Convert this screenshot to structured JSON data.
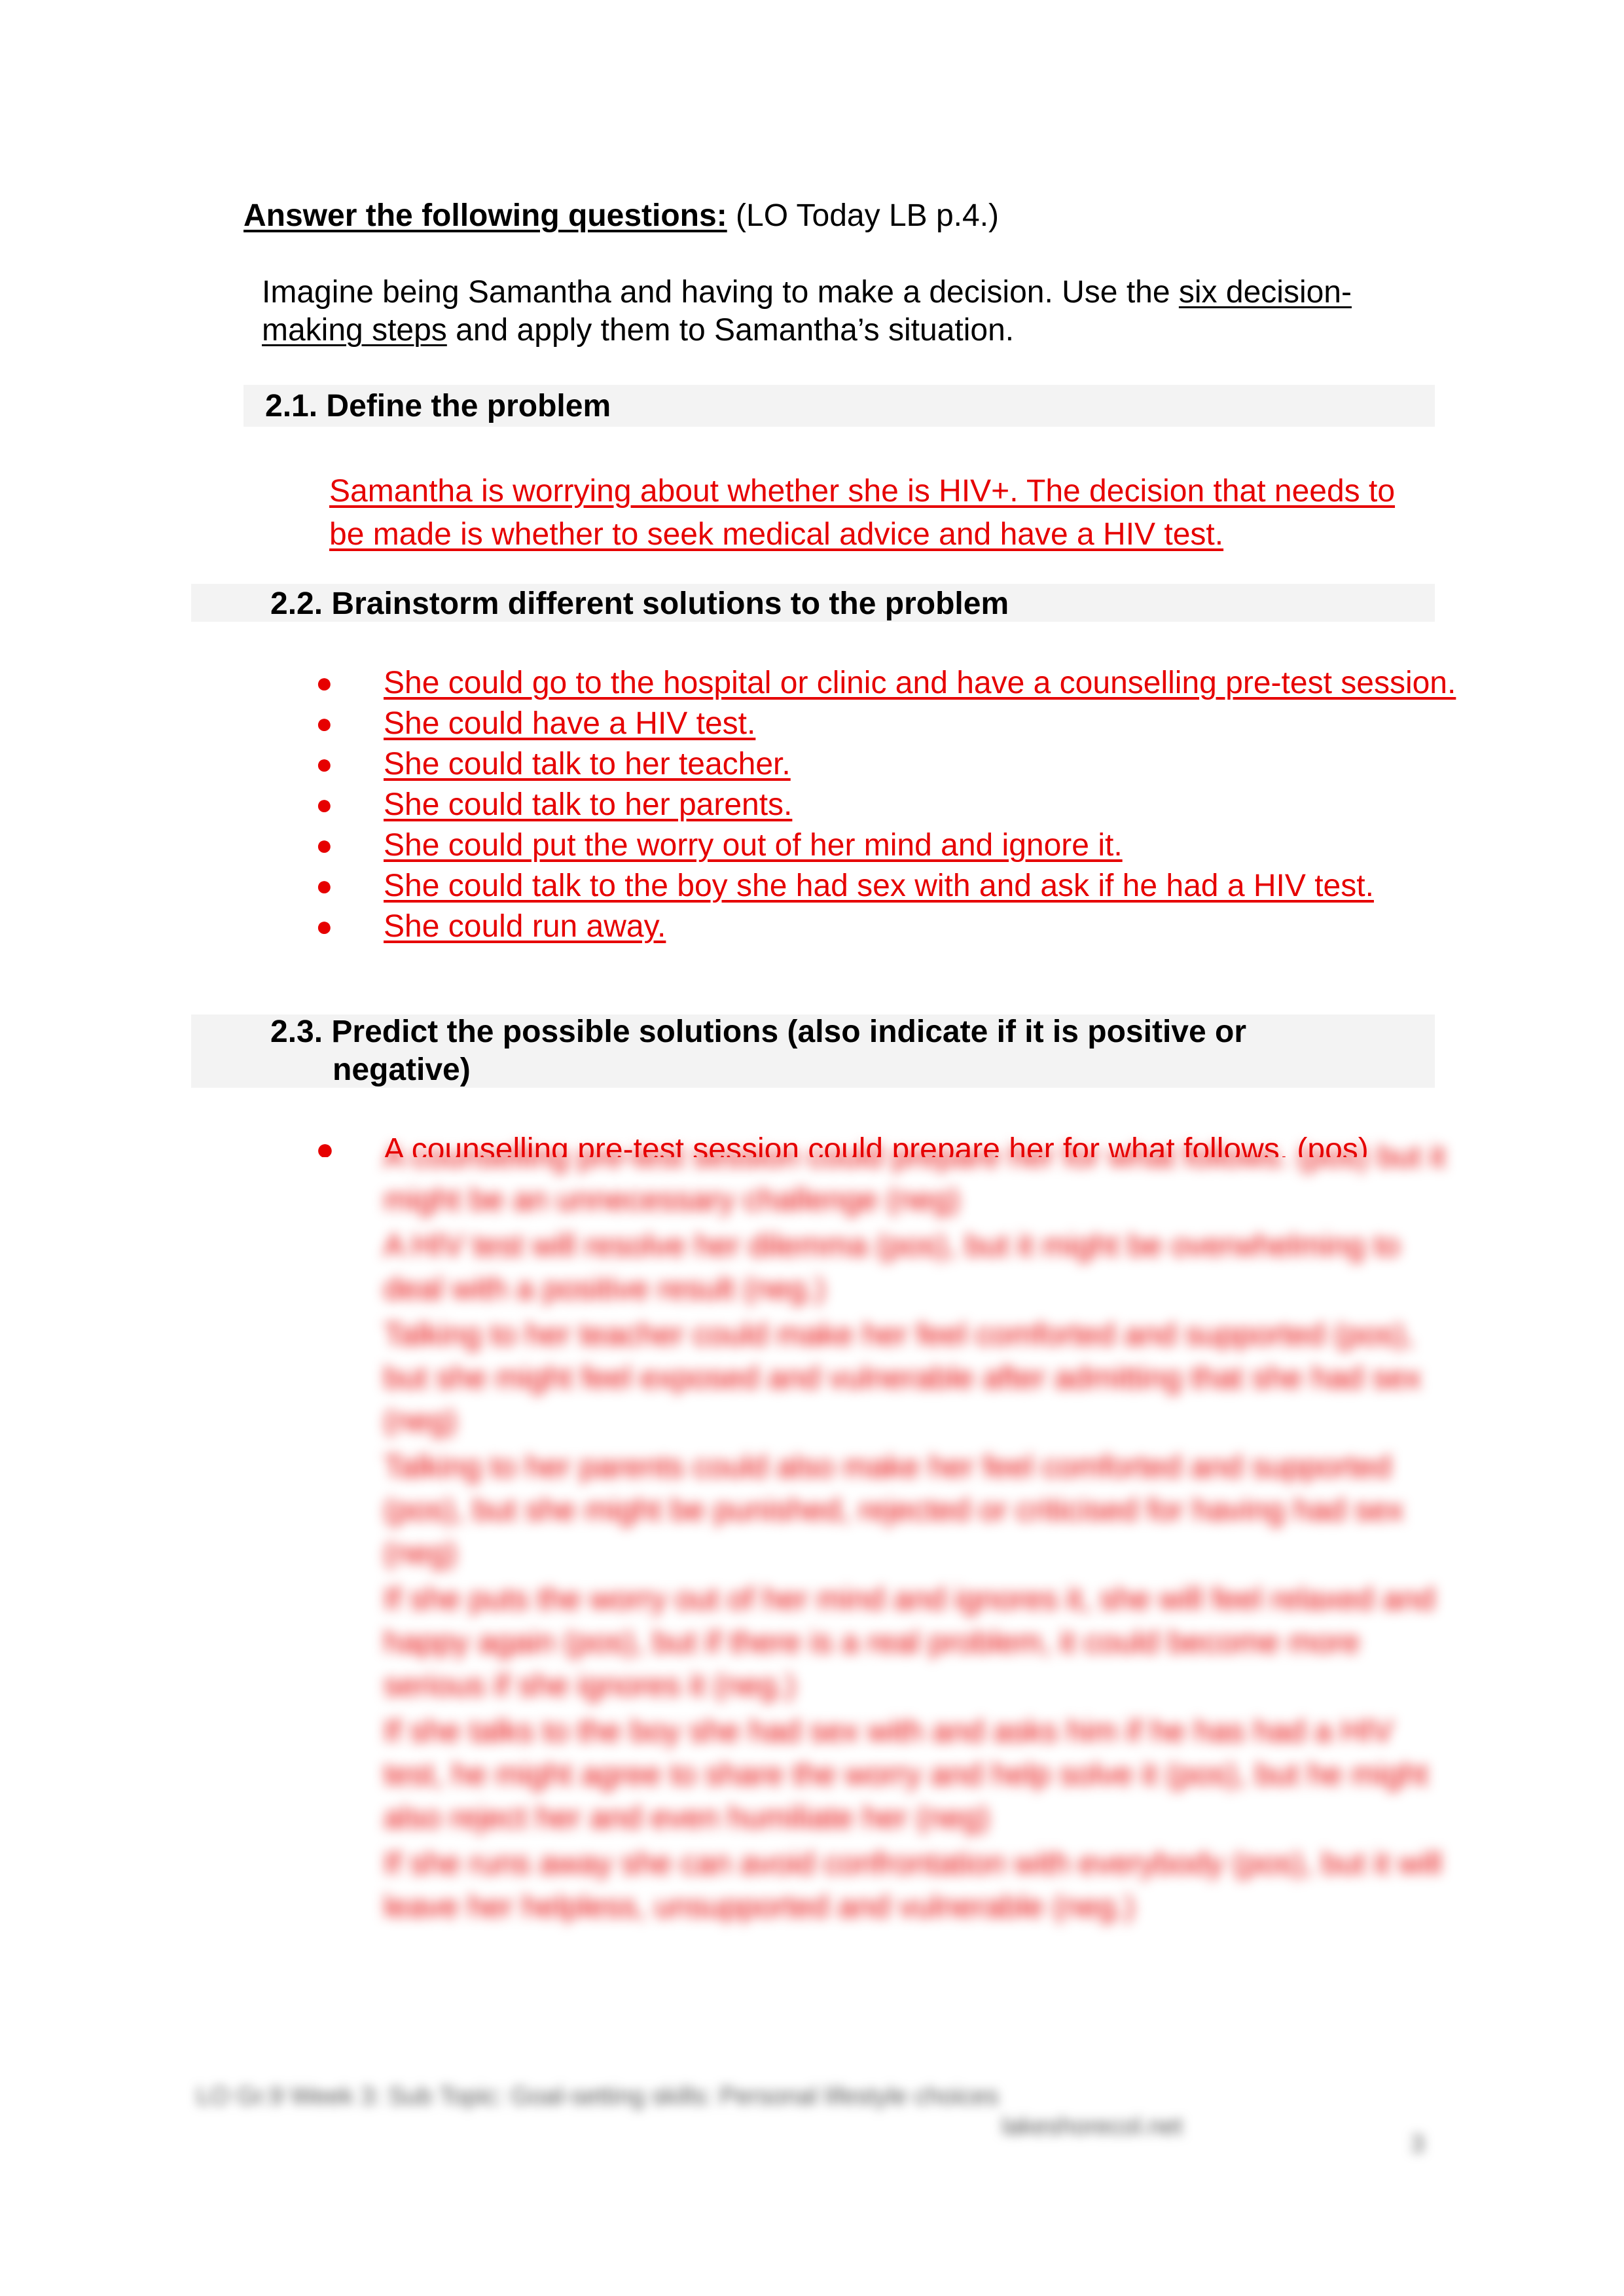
{
  "heading": {
    "bold_label": "Answer the following questions:",
    "reference": "(LO Today LB p.4.)"
  },
  "intro": {
    "part1": "Imagine being Samantha and having to make a decision. Use the ",
    "link_text": "six decision-making steps",
    "part2": " and apply them to Samantha’s situation."
  },
  "sections": [
    {
      "title": "2.1. Define the problem",
      "answer": "Samantha is worrying about whether she is HIV+. The decision that needs to be made is whether to seek medical advice and have a HIV test."
    },
    {
      "title": "2.2. Brainstorm different solutions to the problem",
      "bullets": [
        "She could go to the hospital or clinic and have a counselling pre-test session.",
        "She could have a HIV test.",
        "She could talk to her teacher.",
        "She could talk to her parents.",
        "She could put the worry out of her mind and ignore it.",
        "She could talk to the boy she had sex with and ask if he had a HIV test.",
        "She could run away."
      ]
    },
    {
      "title": "2.3. Predict the possible solutions (also indicate if it is positive or negative)",
      "first_line_partial": "A counselling pre-test session could prepare her for what follows. (pos)",
      "blurred_placeholder_items": [
        "A counselling pre-test session could prepare her for what follows. (pos) but it might be an unnecessary challenge (neg)",
        "A HIV test will resolve her dilemma (pos), but it might be overwhelming to deal with a positive result (neg.)",
        "Talking to her teacher could make her feel comforted and supported (pos), but she might feel exposed and vulnerable after admitting that she had sex (neg)",
        "Talking to her parents could also make her feel comforted and supported (pos), but she might be punished, rejected or criticised for having had sex (neg)",
        "If she puts the worry out of her mind and ignores it, she will feel relaxed and happy again (pos), but if there is a real problem, it could become more serious if she ignores it (neg.)",
        "If she talks to the boy she had sex with and asks him if he has had a HIV test, he might agree to share the worry and help solve it (pos), but he might also reject her and even humiliate her (neg)",
        "If she runs away she can avoid confrontation with everybody (pos), but it will leave her helpless, unsupported and vulnerable (neg.)"
      ]
    }
  ],
  "footer": {
    "line1": "LO Gr.9 Week 3: Sub Topic: Goal-setting skills: Personal lifestyle choices",
    "line2": "lakeshorecol.net",
    "page_number": "3"
  },
  "colors": {
    "answer_red": "#e60000",
    "section_bar": "#f3f3f3"
  }
}
